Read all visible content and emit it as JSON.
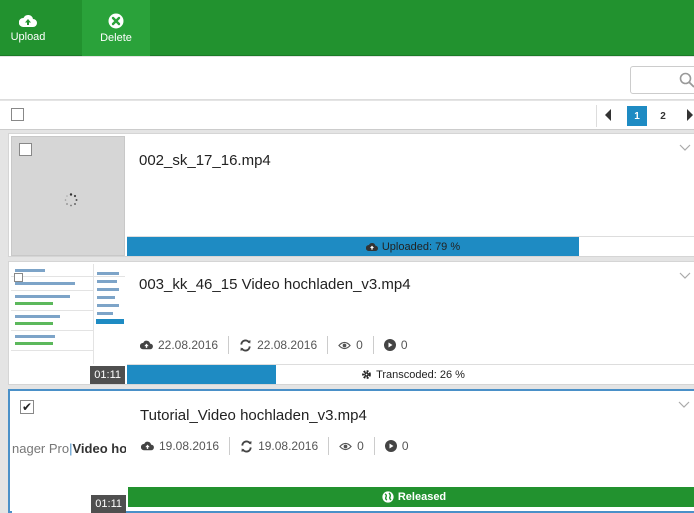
{
  "toolbar": {
    "upload_label": "Upload",
    "delete_label": "Delete",
    "color": "#22922f"
  },
  "search": {
    "placeholder": ""
  },
  "pagination": {
    "pages": [
      "1",
      "2"
    ],
    "current": "1"
  },
  "videos": [
    {
      "title": "002_sk_17_16.mp4",
      "status": "Uploaded: 79 %",
      "progress": 0.79,
      "status_color": "#1e8bc3",
      "checked": false
    },
    {
      "title": "003_kk_46_15 Video hochladen_v3.mp4",
      "created": "22.08.2016",
      "updated": "22.08.2016",
      "views": "0",
      "plays": "0",
      "duration": "01:11",
      "status": "Transcoded: 26 %",
      "progress": 0.26,
      "status_color": "#1e8bc3",
      "checked": false
    },
    {
      "title": "Tutorial_Video hochladen_v3.mp4",
      "created": "19.08.2016",
      "updated": "19.08.2016",
      "views": "0",
      "plays": "0",
      "duration": "01:11",
      "status": "Released",
      "status_color": "#22922f",
      "checked": true,
      "thumb_text_light": "nager Pro",
      "thumb_text_bold": "Video ho",
      "thumb_sep": "|"
    }
  ]
}
